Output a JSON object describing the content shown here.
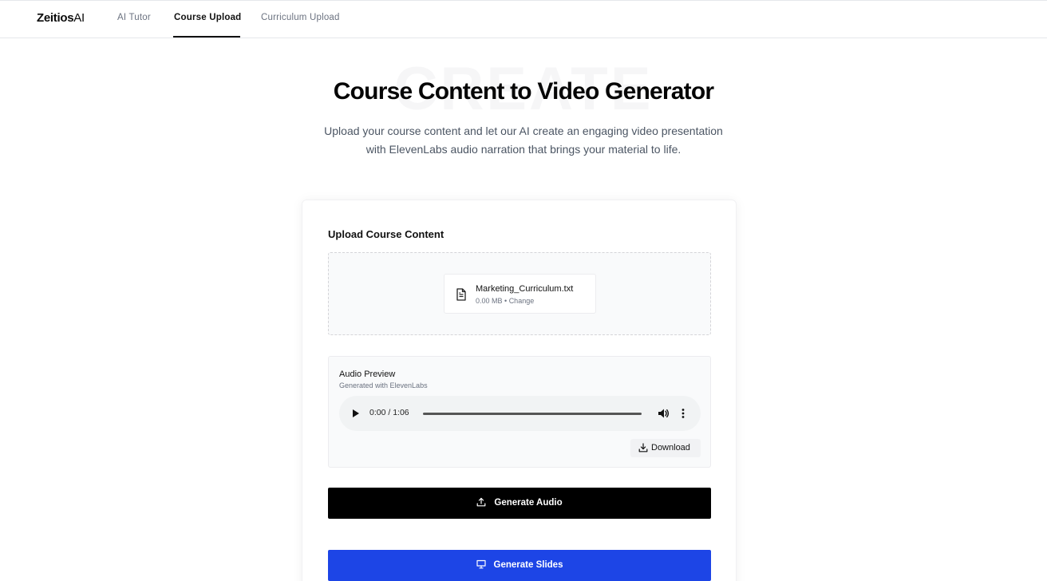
{
  "brand": {
    "name_bold": "Zeitios",
    "name_light": "AI"
  },
  "nav": {
    "tabs": [
      {
        "label": "AI Tutor",
        "active": false
      },
      {
        "label": "Course Upload",
        "active": true
      },
      {
        "label": "Curriculum Upload",
        "active": false
      }
    ]
  },
  "hero": {
    "background_word": "CREATE",
    "title": "Course Content to Video Generator",
    "subtitle_line1": "Upload your course content and let our AI create an engaging video presentation",
    "subtitle_line2": "with ElevenLabs audio narration that brings your material to life."
  },
  "upload": {
    "section_title": "Upload Course Content",
    "file": {
      "name": "Marketing_Curriculum.txt",
      "size": "0.00 MB",
      "separator": " • ",
      "change_label": "Change",
      "icon": "file-text-icon"
    }
  },
  "audio_preview": {
    "title": "Audio Preview",
    "subtitle": "Generated with ElevenLabs",
    "player": {
      "current_time": "0:00",
      "duration": "1:06",
      "time_display": "0:00 / 1:06",
      "progress": 0
    },
    "download_label": "Download"
  },
  "actions": {
    "generate_audio_label": "Generate Audio",
    "generate_slides_label": "Generate Slides"
  },
  "colors": {
    "primary_black": "#000000",
    "slides_blue": "#1d45e6",
    "muted_text": "#6b7280"
  }
}
